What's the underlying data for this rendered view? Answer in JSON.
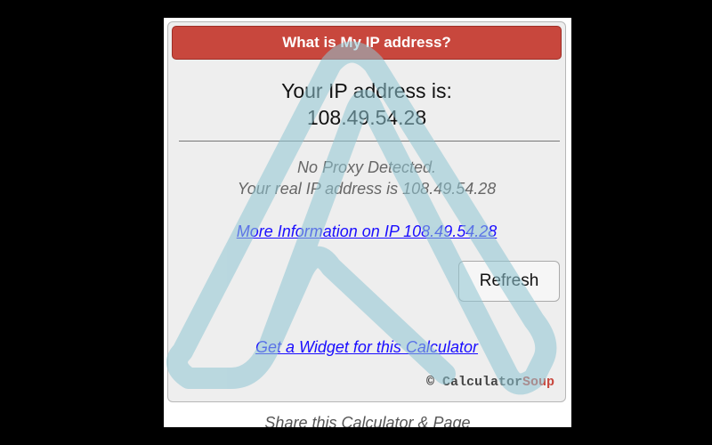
{
  "widget": {
    "title": "What is My IP address?",
    "ip_label": "Your IP address is:",
    "ip_value": "108.49.54.28",
    "proxy_status": "No Proxy Detected.",
    "real_ip_text": "Your real IP address is 108.49.54.28",
    "more_info_link": "More Information on IP 108.49.54.28",
    "refresh_label": "Refresh",
    "widget_link": "Get a Widget for this Calculator",
    "brand_copyright": "©",
    "brand_name_a": "Calculator",
    "brand_name_b": "Soup"
  },
  "footer": {
    "share_text": "Share this Calculator & Page"
  },
  "colors": {
    "title_bar": "#c8473d",
    "link": "#1a0dff",
    "watermark": "#8fc6d3"
  }
}
